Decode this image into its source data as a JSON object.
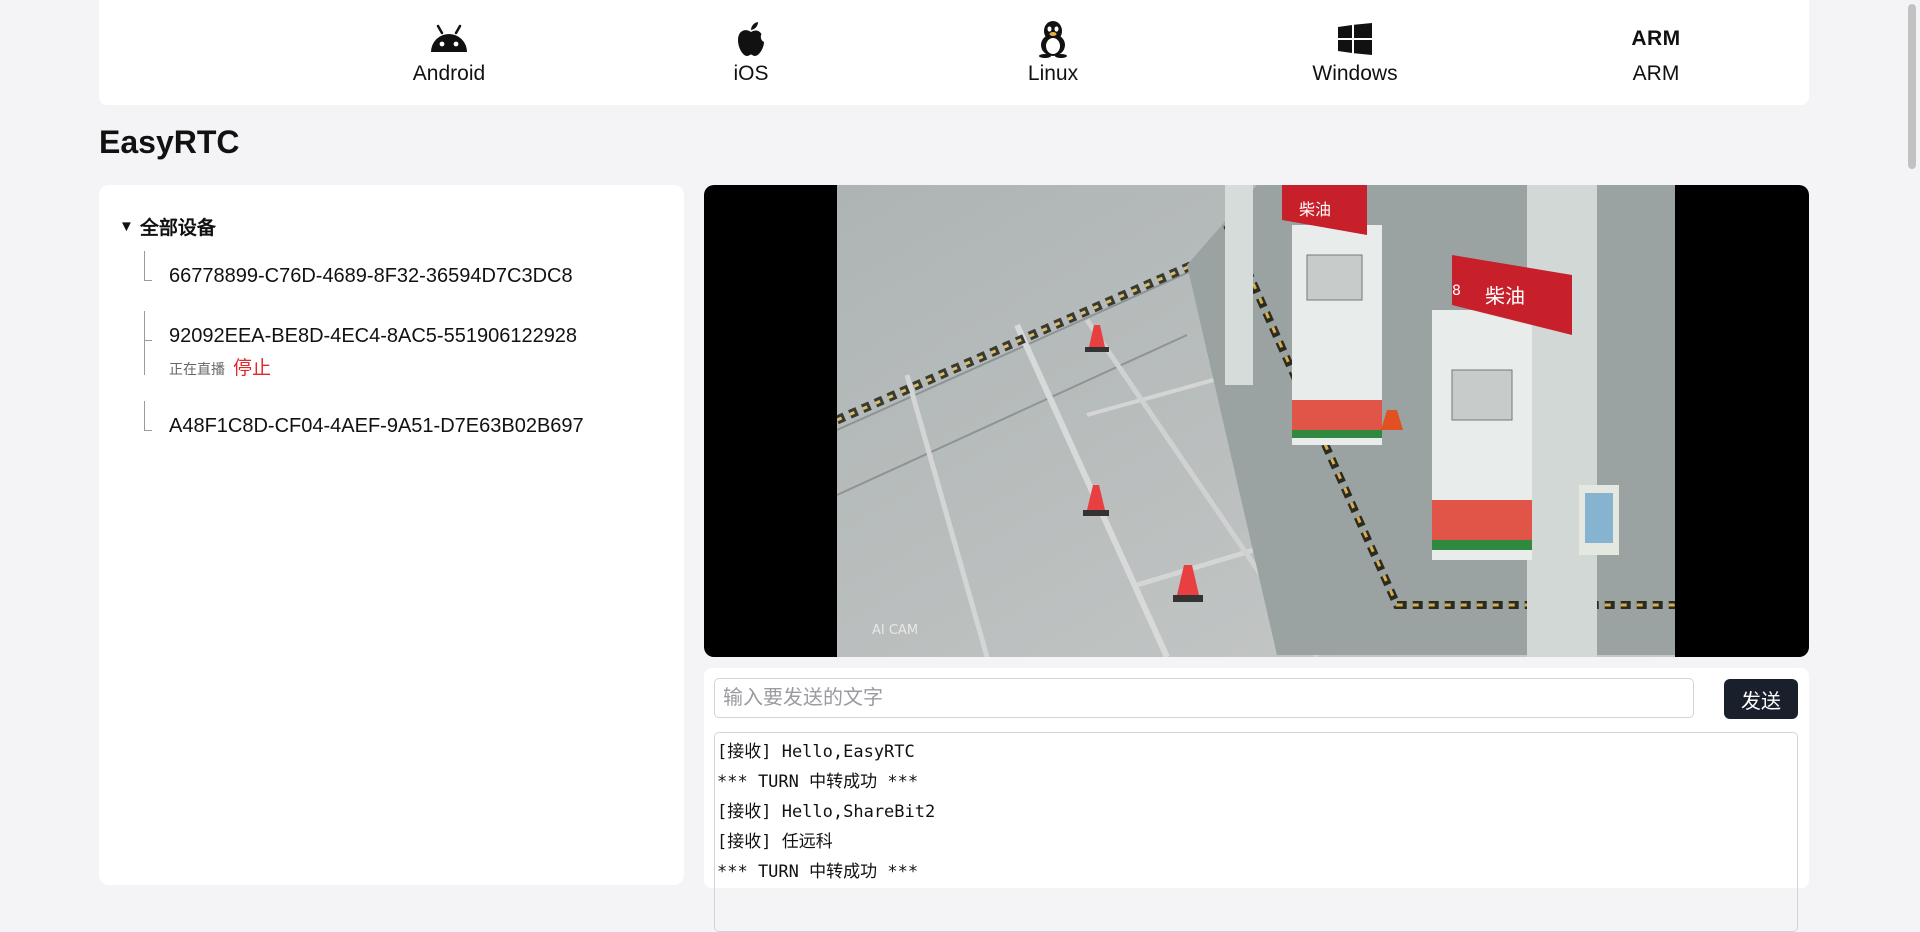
{
  "platforms": [
    {
      "label": "Android",
      "icon": "android-icon"
    },
    {
      "label": "iOS",
      "icon": "apple-icon"
    },
    {
      "label": "Linux",
      "icon": "linux-penguin-icon"
    },
    {
      "label": "Windows",
      "icon": "windows-icon"
    },
    {
      "label": "ARM",
      "icon": "arm-logo",
      "logo_text": "ARM"
    }
  ],
  "page": {
    "title": "EasyRTC"
  },
  "device_tree": {
    "root_label": "全部设备",
    "root_expanded": true,
    "devices": [
      {
        "id": "66778899-C76D-4689-8F32-36594D7C3DC8"
      },
      {
        "id": "92092EEA-BE8D-4EC4-8AC5-551906122928",
        "status": "正在直播",
        "action": "停止"
      },
      {
        "id": "A48F1C8D-CF04-4AEF-9A51-D7E63B02B697"
      }
    ]
  },
  "video": {
    "overlay_text": "AI CAM",
    "sign_text": "柴油",
    "sign_number": "8"
  },
  "chat": {
    "input_placeholder": "输入要发送的文字",
    "input_value": "",
    "send_label": "发送",
    "log": [
      "[接收] Hello,EasyRTC",
      "*** TURN 中转成功 ***",
      "[接收] Hello,ShareBit2",
      "[接收] 任远科",
      "*** TURN 中转成功 ***"
    ]
  },
  "colors": {
    "background": "#f4f4f6",
    "panel": "#ffffff",
    "send_button": "#1a1f2c",
    "stop_action": "#e0282a",
    "sign_red": "#c8202a"
  }
}
